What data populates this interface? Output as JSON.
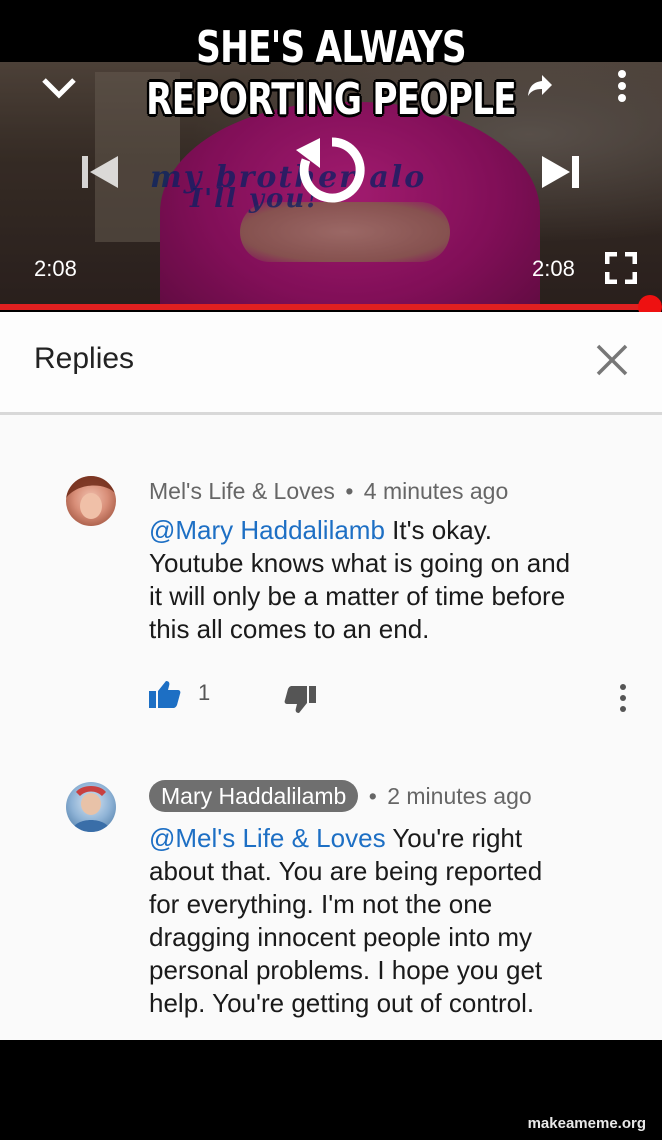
{
  "meme": {
    "caption_line1": "SHE'S ALWAYS",
    "caption_line2": "REPORTING PEOPLE",
    "watermark": "makeameme.org"
  },
  "player": {
    "elapsed": "2:08",
    "duration": "2:08",
    "progress": 1.0,
    "overlay_text_line1": "my brother alo",
    "overlay_text_line2": "I'll you!",
    "accent_color": "#e02020"
  },
  "panel": {
    "title": "Replies"
  },
  "comments": [
    {
      "author": "Mel's Life & Loves",
      "separator": "•",
      "time": "4 minutes ago",
      "mention": "@Mary Haddalilamb",
      "text_lines": [
        " It's okay.",
        "Youtube knows what is going on and",
        "it will only be a matter of time before",
        "this all comes to an end."
      ],
      "likes": "1"
    },
    {
      "author": "Mary Haddalilamb",
      "separator": "•",
      "time": "2 minutes ago",
      "mention": "@Mel's Life & Loves",
      "text_lines": [
        " You're right",
        "about that. You are being reported",
        "for everything. I'm not the one",
        "dragging innocent people into my",
        "personal problems. I hope you get",
        "help. You're getting out of control."
      ]
    }
  ],
  "icons": [
    "chevron-down-icon",
    "share-icon",
    "more-vert-icon",
    "skip-previous-icon",
    "replay-icon",
    "skip-next-icon",
    "fullscreen-icon",
    "close-icon",
    "thumb-up-icon",
    "thumb-down-icon",
    "more-vert-icon"
  ]
}
